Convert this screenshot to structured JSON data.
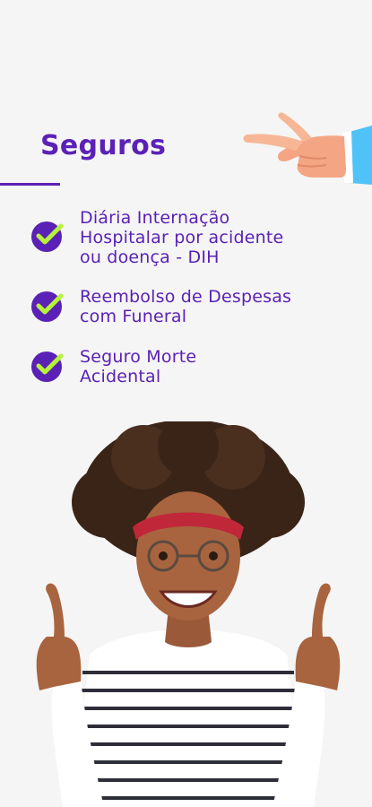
{
  "section": {
    "title": "Seguros"
  },
  "benefits": [
    {
      "text": "Diária Internação\nHospitalar por acidente\nou doença - DIH"
    },
    {
      "text": "Reembolso de Despesas\ncom Funeral"
    },
    {
      "text": "Seguro Morte\nAcidental"
    }
  ],
  "icons": {
    "check": "check-circle-icon",
    "hand": "pointing-hand-icon"
  },
  "colors": {
    "primary": "#5b21b6",
    "accent": "#b5f23a",
    "background": "#f5f5f5",
    "sleeve": "#4fc3f7"
  }
}
